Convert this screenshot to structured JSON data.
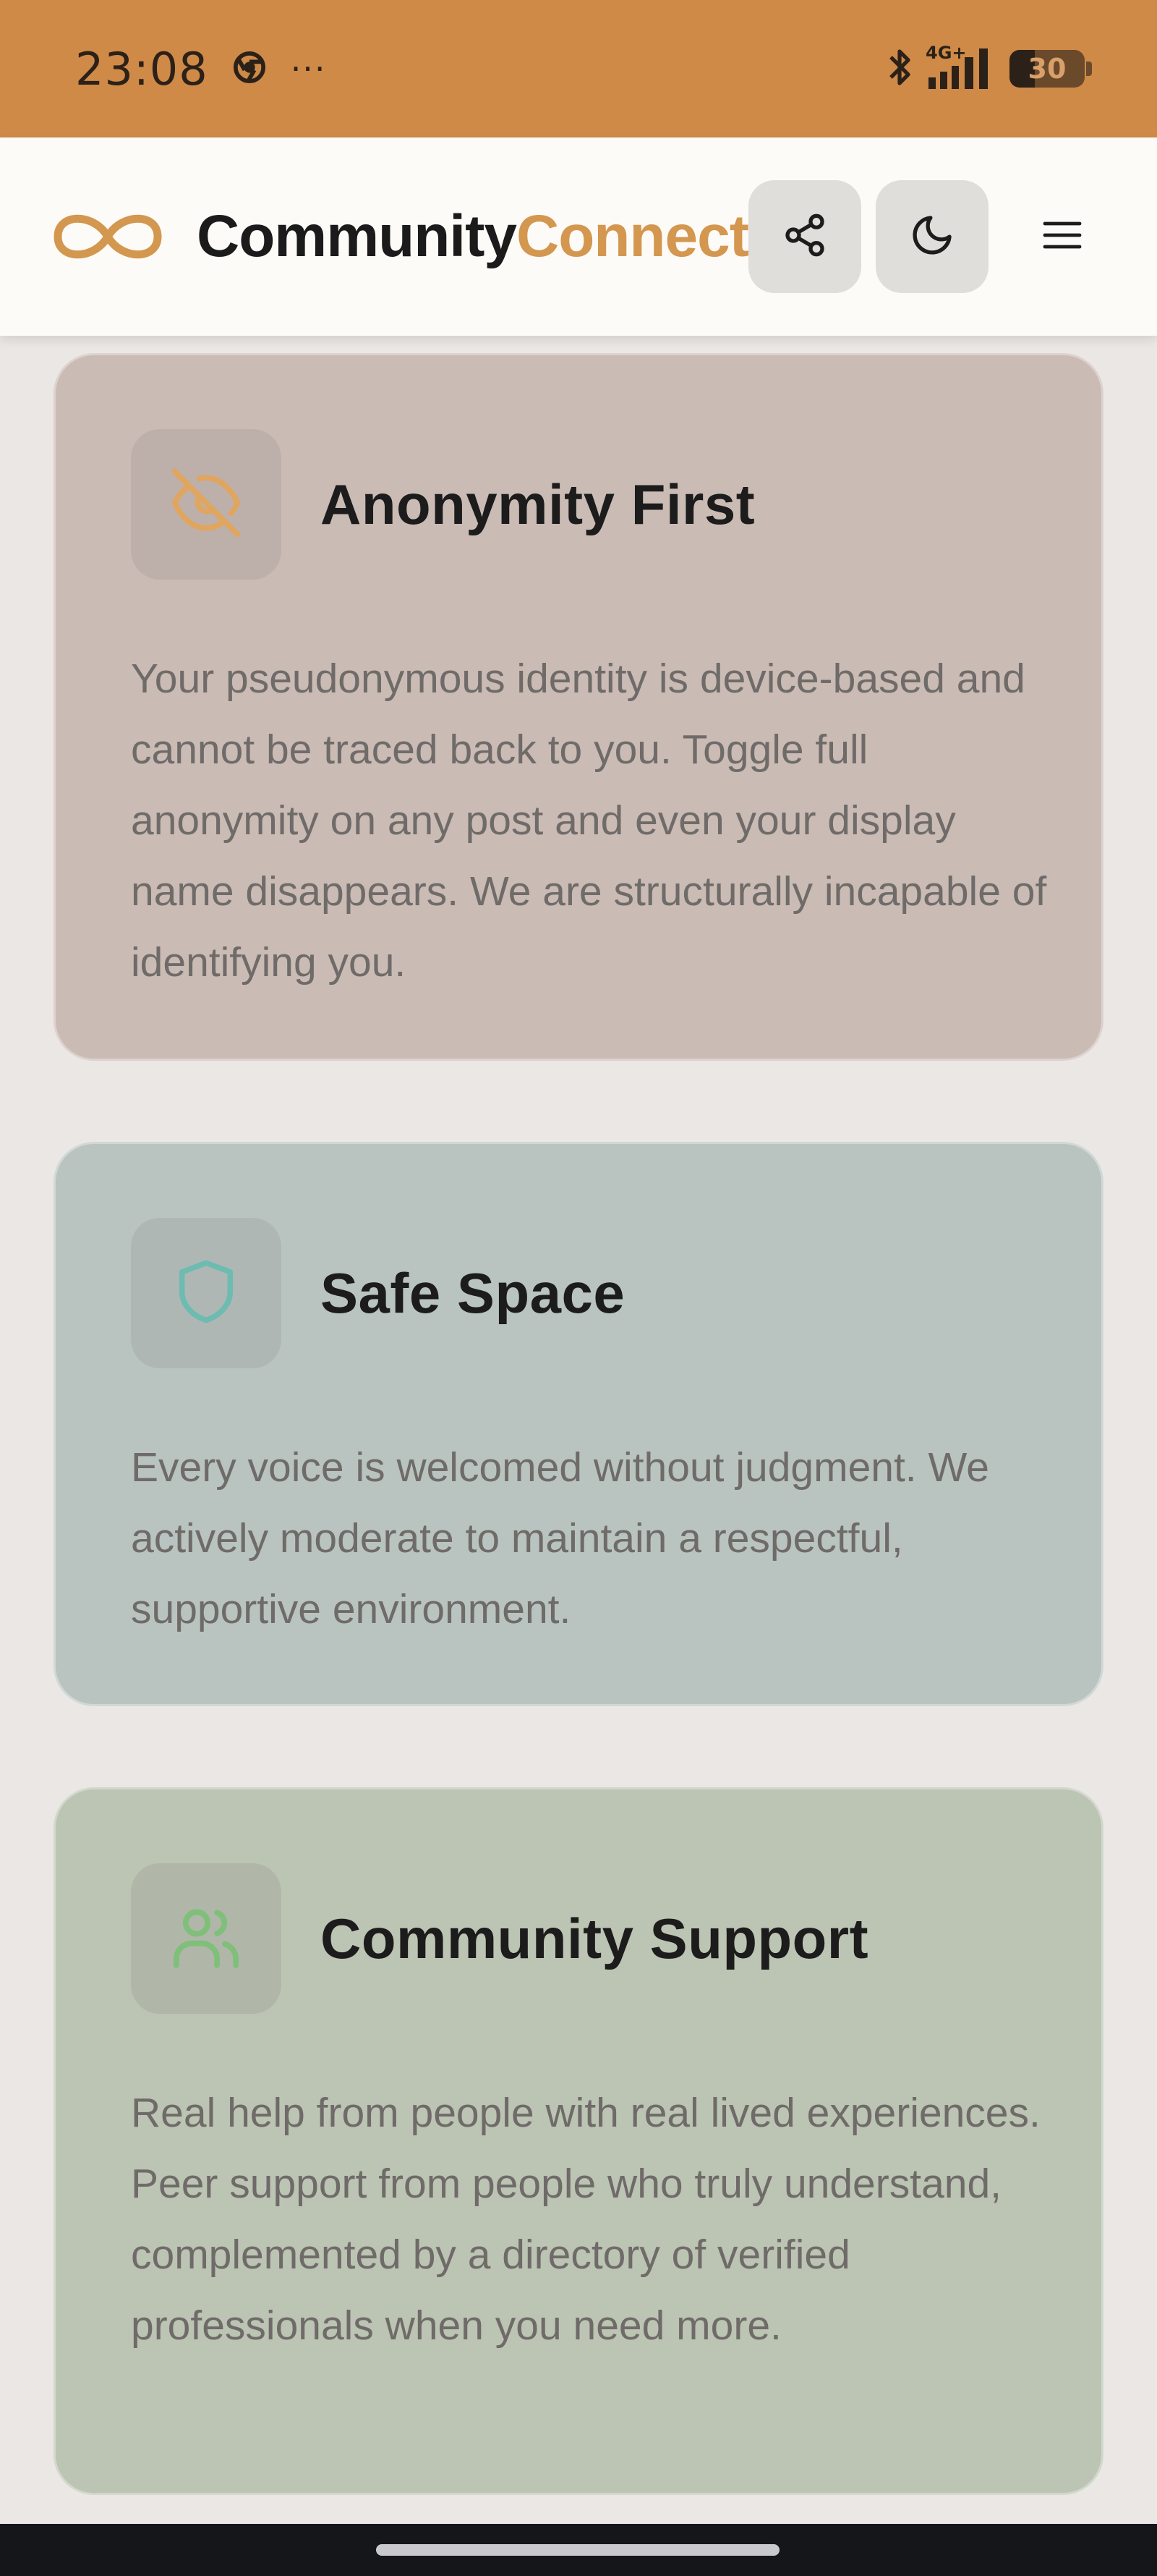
{
  "status_bar": {
    "time": "23:08",
    "overflow": "···",
    "network": "4G+",
    "battery": "30",
    "background": "#cf8a48"
  },
  "header": {
    "brand_part1": "Community",
    "brand_part2": "Connect",
    "brand_accent": "#d4974f",
    "icons": [
      "infinity-logo-icon",
      "share-icon",
      "moon-icon",
      "hamburger-menu-icon"
    ]
  },
  "features": [
    {
      "title": "Anonymity First",
      "description": "Your pseudonymous identity is device-based and cannot be traced back to you. Toggle full anonymity on any post and even your display name disappears. We are structurally incapable of identifying you.",
      "icon": "eye-off-icon",
      "icon_color": "#e0a55f",
      "background": "#cbbbb5"
    },
    {
      "title": "Safe Space",
      "description": "Every voice is welcomed without judgment. We actively moderate to maintain a respectful, supportive environment.",
      "icon": "shield-icon",
      "icon_color": "#6dbbb1",
      "background": "#b9c4c0"
    },
    {
      "title": "Community Support",
      "description": "Real help from people with real lived experiences. Peer support from people who truly understand, complemented by a directory of verified professionals when you need more.",
      "icon": "users-icon",
      "icon_color": "#7fbf7a",
      "background": "#bcc4b3"
    }
  ]
}
